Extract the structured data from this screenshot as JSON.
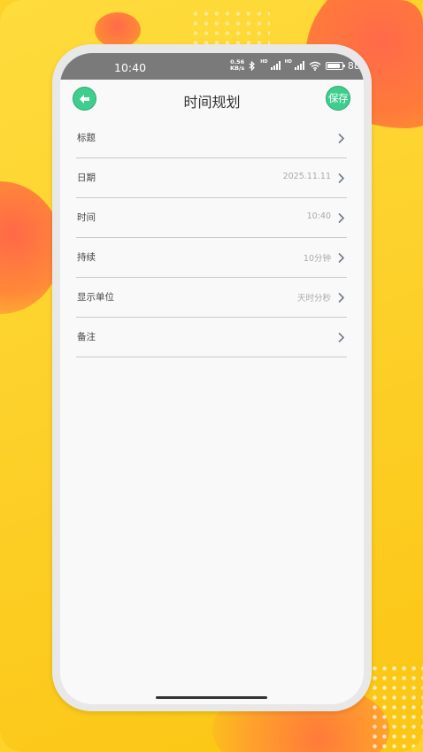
{
  "status_bar": {
    "time": "10:40",
    "net_speed_value": "0.56",
    "net_speed_unit": "KB/s",
    "battery_percent": "88%",
    "battery_level": 0.88
  },
  "header": {
    "title": "时间规划",
    "save_label": "保存"
  },
  "rows": [
    {
      "label": "标题",
      "value": ""
    },
    {
      "label": "日期",
      "value": "2025.11.11"
    },
    {
      "label": "时间",
      "value": "10:40"
    },
    {
      "label": "持续",
      "value": "10分钟"
    },
    {
      "label": "显示单位",
      "value": "天时分秒"
    },
    {
      "label": "备注",
      "value": ""
    }
  ],
  "colors": {
    "accent": "#3fce8e",
    "background": "#fdd22a",
    "blob": "#ff6a4a",
    "status_bar": "#7a7a7a"
  },
  "icons": {
    "back": "arrow-left-icon",
    "row_chevron": "chevron-right-icon"
  }
}
